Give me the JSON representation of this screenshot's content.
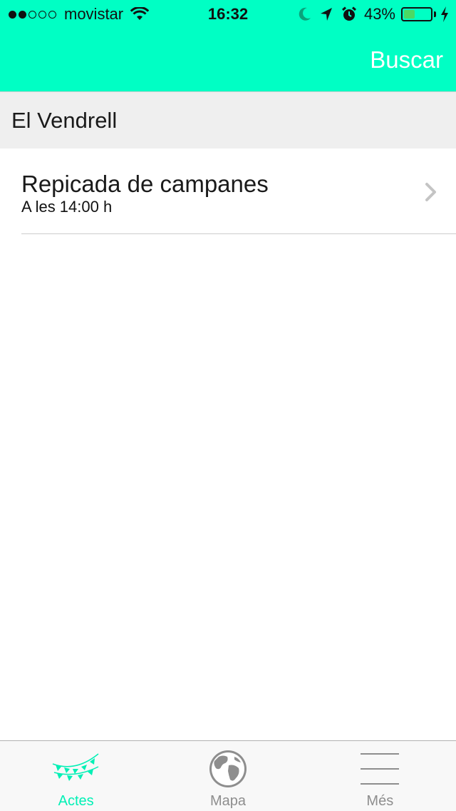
{
  "status_bar": {
    "carrier": "movistar",
    "time": "16:32",
    "battery_percent": "43%",
    "battery_level": 0.43,
    "signal_filled": 2,
    "signal_total": 5,
    "icons": [
      "wifi-icon",
      "moon-icon",
      "location-arrow-icon",
      "alarm-icon",
      "battery-icon",
      "charging-bolt-icon"
    ]
  },
  "nav": {
    "search_label": "Buscar"
  },
  "section": {
    "title": "El Vendrell"
  },
  "events": [
    {
      "title": "Repicada de campanes",
      "time": "A les 14:00 h"
    }
  ],
  "tabs": [
    {
      "label": "Actes",
      "icon": "bunting-flags-icon",
      "active": true
    },
    {
      "label": "Mapa",
      "icon": "globe-icon",
      "active": false
    },
    {
      "label": "Més",
      "icon": "menu-lines-icon",
      "active": false
    }
  ],
  "colors": {
    "header": "#00ffc4",
    "accent": "#00f0b5",
    "inactive_tab": "#8e8e8e",
    "section_bg": "#efefef"
  }
}
